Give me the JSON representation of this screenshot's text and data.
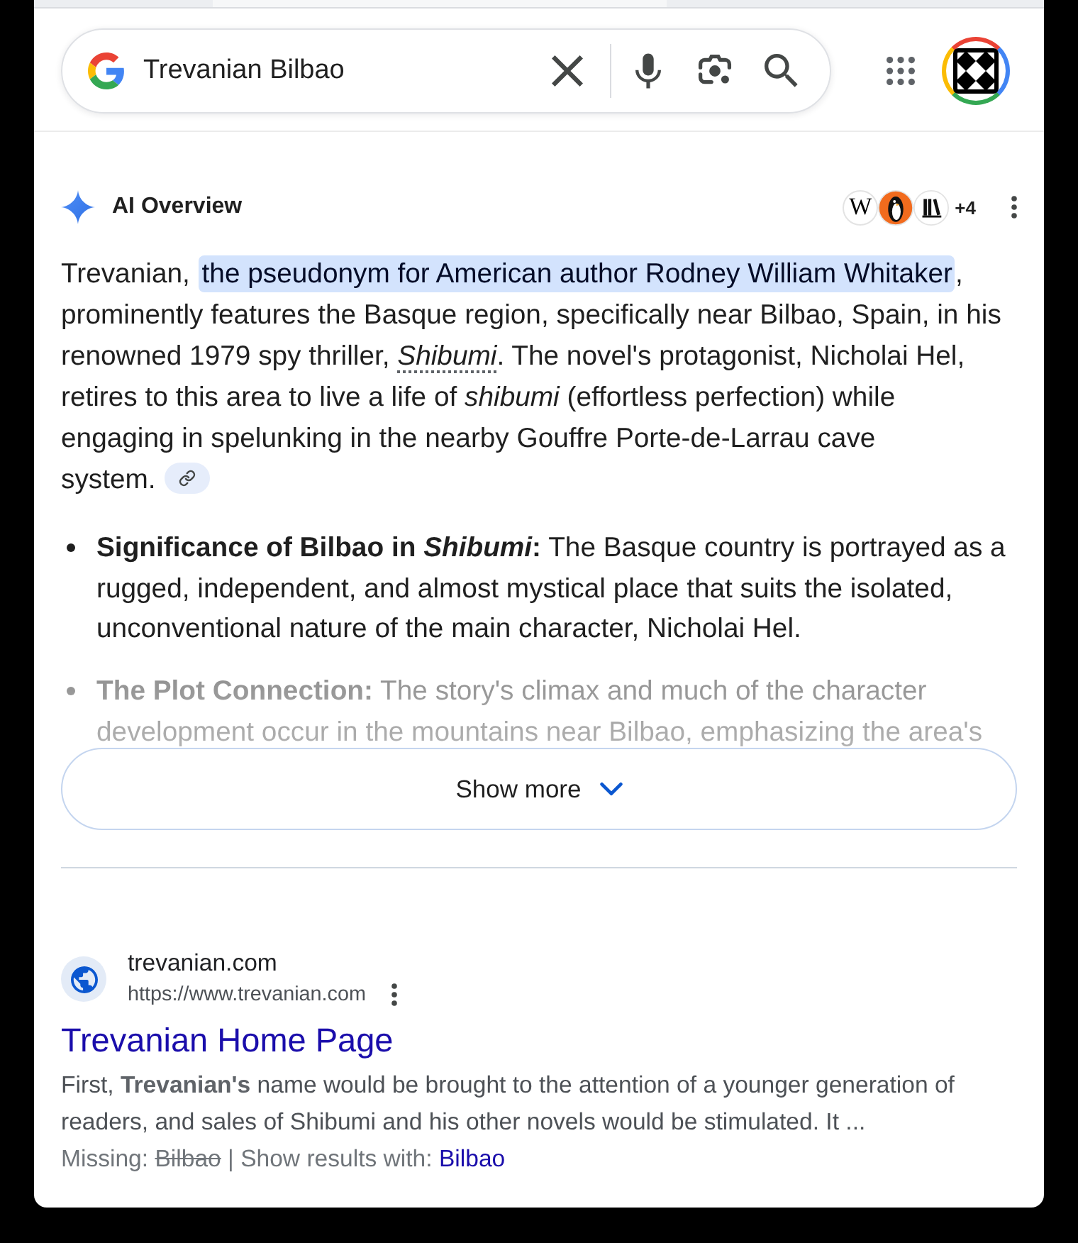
{
  "search": {
    "query": "Trevanian Bilbao"
  },
  "ai_overview": {
    "title": "AI Overview",
    "sources": [
      {
        "kind": "letter",
        "glyph": "W"
      },
      {
        "kind": "penguin"
      },
      {
        "kind": "books"
      }
    ],
    "more_sources": "+4",
    "summary": [
      {
        "kind": "text",
        "text": "Trevanian, "
      },
      {
        "kind": "highlight",
        "text": "the pseudonym for American author Rodney William Whitaker"
      },
      {
        "kind": "text",
        "text": ", prominently features the Basque region, specifically near Bilbao, Spain, in his renowned 1979 spy thriller, "
      },
      {
        "kind": "term",
        "text": "Shibumi"
      },
      {
        "kind": "text",
        "text": ". The novel's protagonist, Nicholai Hel, retires to this area to live a life of *shibumi* (effortless perfection) while engaging in spelunking in the nearby Gouffre Porte-de-Larrau cave system."
      }
    ],
    "bullets": [
      {
        "label": "Significance of Bilbao in *Shibumi*:",
        "text": "The Basque country is portrayed as a rugged, independent, and almost mystical place that suits the isolated, unconventional nature of the main character, Nicholai Hel.",
        "faded": false
      },
      {
        "label": "The Plot Connection:",
        "text": "The story's climax and much of the character development occur in the mountains near Bilbao, emphasizing the area's",
        "faded": true
      }
    ],
    "show_more": "Show more"
  },
  "result": {
    "site_name": "trevanian.com",
    "url": "https://www.trevanian.com",
    "title": "Trevanian Home Page",
    "snippet": "First, **Trevanian's** name would be brought to the attention of a younger generation of readers, and sales of Shibumi and his other novels would be stimulated. It ...",
    "missing_label": "Missing:",
    "missing_term": "Bilbao",
    "show_with_label": "| Show results with:",
    "show_with_term": "Bilbao"
  }
}
